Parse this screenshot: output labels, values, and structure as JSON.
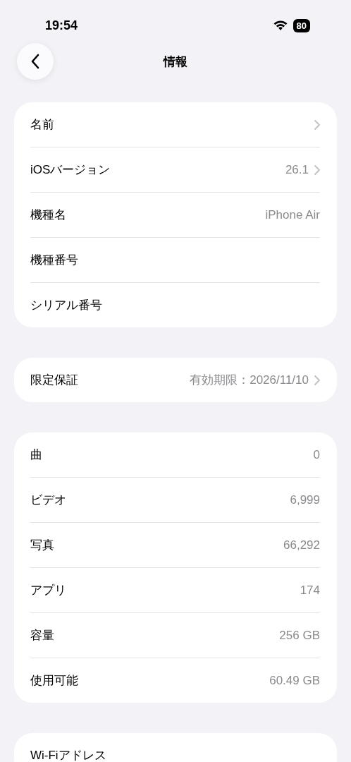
{
  "status_bar": {
    "time": "19:54",
    "battery": "80"
  },
  "nav": {
    "title": "情報"
  },
  "groups": [
    {
      "rows": [
        {
          "label": "名前",
          "disclosure": true
        },
        {
          "label": "iOSバージョン",
          "value": "26.1",
          "disclosure": true
        },
        {
          "label": "機種名",
          "value": "iPhone Air",
          "disclosure": false
        },
        {
          "label": "機種番号",
          "disclosure": false
        },
        {
          "label": "シリアル番号",
          "disclosure": false
        }
      ]
    },
    {
      "rows": [
        {
          "label": "限定保証",
          "value": "有効期限：2026/11/10",
          "disclosure": true
        }
      ]
    },
    {
      "rows": [
        {
          "label": "曲",
          "value": "0",
          "disclosure": false
        },
        {
          "label": "ビデオ",
          "value": "6,999",
          "disclosure": false
        },
        {
          "label": "写真",
          "value": "66,292",
          "disclosure": false
        },
        {
          "label": "アプリ",
          "value": "174",
          "disclosure": false
        },
        {
          "label": "容量",
          "value": "256 GB",
          "disclosure": false
        },
        {
          "label": "使用可能",
          "value": "60.49 GB",
          "disclosure": false
        }
      ]
    },
    {
      "rows": [
        {
          "label": "Wi-Fiアドレス",
          "disclosure": false
        }
      ]
    }
  ]
}
